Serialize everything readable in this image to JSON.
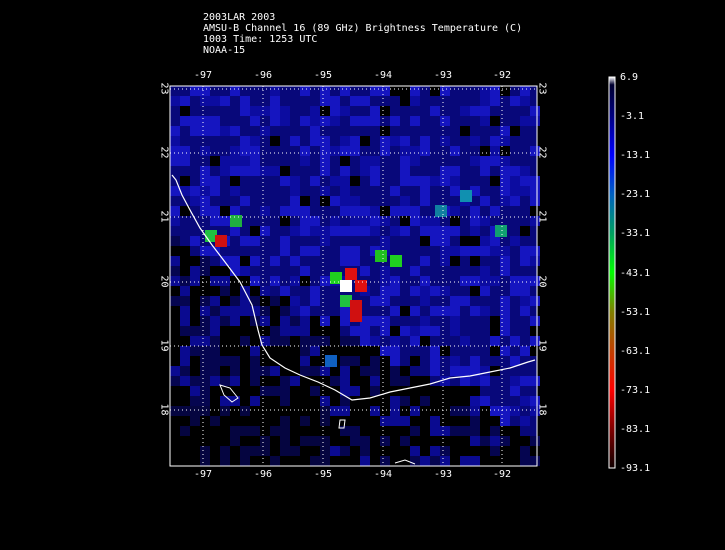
{
  "title": {
    "line1": "2003LAR 2003",
    "line2": "AMSU-B Channel 16 (89 GHz) Brightness Temperature (C)",
    "line3": "1003 Time: 1253 UTC",
    "line4": "NOAA-15"
  },
  "lon_ticks": [
    "-97",
    "-96",
    "-95",
    "-94",
    "-93",
    "-92"
  ],
  "lat_ticks": [
    "23",
    "22",
    "21",
    "20",
    "19",
    "18"
  ],
  "colorbar": {
    "labels": [
      "6.9",
      "-3.1",
      "-13.1",
      "-23.1",
      "-33.1",
      "-43.1",
      "-53.1",
      "-63.1",
      "-73.1",
      "-83.1",
      "-93.1"
    ],
    "range": [
      -93.1,
      6.9
    ]
  },
  "colors": {
    "background": "#000000",
    "dark_blue": "#0a0a90",
    "blue": "#1a1ae0",
    "green": "#20d020",
    "red": "#e01010",
    "coast": "#ffffff"
  }
}
